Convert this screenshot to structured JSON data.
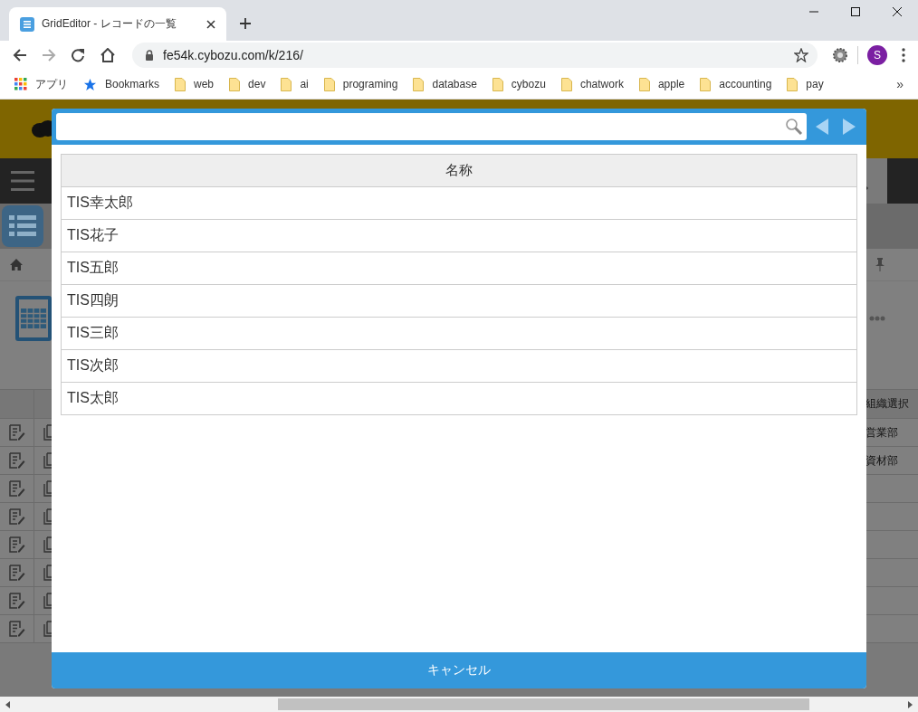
{
  "browser": {
    "tab_title": "GridEditor - レコードの一覧",
    "url": "fe54k.cybozu.com/k/216/",
    "profile_initial": "S",
    "bookmarks": [
      {
        "label": "アプリ",
        "kind": "apps"
      },
      {
        "label": "Bookmarks",
        "kind": "star"
      },
      {
        "label": "web",
        "kind": "folder"
      },
      {
        "label": "dev",
        "kind": "folder"
      },
      {
        "label": "ai",
        "kind": "folder"
      },
      {
        "label": "programing",
        "kind": "folder"
      },
      {
        "label": "database",
        "kind": "folder"
      },
      {
        "label": "cybozu",
        "kind": "folder"
      },
      {
        "label": "chatwork",
        "kind": "folder"
      },
      {
        "label": "apple",
        "kind": "folder"
      },
      {
        "label": "accounting",
        "kind": "folder"
      },
      {
        "label": "pay",
        "kind": "folder"
      }
    ],
    "more_bookmarks": "»"
  },
  "background": {
    "column_header": "組織選択",
    "cells": [
      "営業部",
      "資材部"
    ]
  },
  "dialog": {
    "column": "名称",
    "rows": [
      "TIS幸太郎",
      "TIS花子",
      "TIS五郎",
      "TIS四朗",
      "TIS三郎",
      "TIS次郎",
      "TIS太郎"
    ],
    "cancel": "キャンセル"
  }
}
